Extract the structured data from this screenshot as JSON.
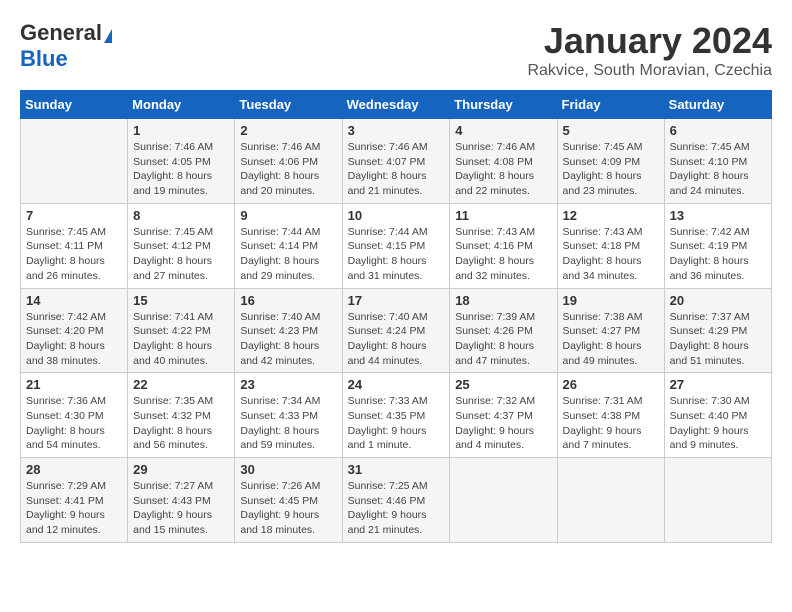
{
  "logo": {
    "general": "General",
    "blue": "Blue"
  },
  "title": "January 2024",
  "subtitle": "Rakvice, South Moravian, Czechia",
  "days_of_week": [
    "Sunday",
    "Monday",
    "Tuesday",
    "Wednesday",
    "Thursday",
    "Friday",
    "Saturday"
  ],
  "weeks": [
    [
      {
        "day": "",
        "info": ""
      },
      {
        "day": "1",
        "info": "Sunrise: 7:46 AM\nSunset: 4:05 PM\nDaylight: 8 hours and 19 minutes."
      },
      {
        "day": "2",
        "info": "Sunrise: 7:46 AM\nSunset: 4:06 PM\nDaylight: 8 hours and 20 minutes."
      },
      {
        "day": "3",
        "info": "Sunrise: 7:46 AM\nSunset: 4:07 PM\nDaylight: 8 hours and 21 minutes."
      },
      {
        "day": "4",
        "info": "Sunrise: 7:46 AM\nSunset: 4:08 PM\nDaylight: 8 hours and 22 minutes."
      },
      {
        "day": "5",
        "info": "Sunrise: 7:45 AM\nSunset: 4:09 PM\nDaylight: 8 hours and 23 minutes."
      },
      {
        "day": "6",
        "info": "Sunrise: 7:45 AM\nSunset: 4:10 PM\nDaylight: 8 hours and 24 minutes."
      }
    ],
    [
      {
        "day": "7",
        "info": "Sunrise: 7:45 AM\nSunset: 4:11 PM\nDaylight: 8 hours and 26 minutes."
      },
      {
        "day": "8",
        "info": "Sunrise: 7:45 AM\nSunset: 4:12 PM\nDaylight: 8 hours and 27 minutes."
      },
      {
        "day": "9",
        "info": "Sunrise: 7:44 AM\nSunset: 4:14 PM\nDaylight: 8 hours and 29 minutes."
      },
      {
        "day": "10",
        "info": "Sunrise: 7:44 AM\nSunset: 4:15 PM\nDaylight: 8 hours and 31 minutes."
      },
      {
        "day": "11",
        "info": "Sunrise: 7:43 AM\nSunset: 4:16 PM\nDaylight: 8 hours and 32 minutes."
      },
      {
        "day": "12",
        "info": "Sunrise: 7:43 AM\nSunset: 4:18 PM\nDaylight: 8 hours and 34 minutes."
      },
      {
        "day": "13",
        "info": "Sunrise: 7:42 AM\nSunset: 4:19 PM\nDaylight: 8 hours and 36 minutes."
      }
    ],
    [
      {
        "day": "14",
        "info": "Sunrise: 7:42 AM\nSunset: 4:20 PM\nDaylight: 8 hours and 38 minutes."
      },
      {
        "day": "15",
        "info": "Sunrise: 7:41 AM\nSunset: 4:22 PM\nDaylight: 8 hours and 40 minutes."
      },
      {
        "day": "16",
        "info": "Sunrise: 7:40 AM\nSunset: 4:23 PM\nDaylight: 8 hours and 42 minutes."
      },
      {
        "day": "17",
        "info": "Sunrise: 7:40 AM\nSunset: 4:24 PM\nDaylight: 8 hours and 44 minutes."
      },
      {
        "day": "18",
        "info": "Sunrise: 7:39 AM\nSunset: 4:26 PM\nDaylight: 8 hours and 47 minutes."
      },
      {
        "day": "19",
        "info": "Sunrise: 7:38 AM\nSunset: 4:27 PM\nDaylight: 8 hours and 49 minutes."
      },
      {
        "day": "20",
        "info": "Sunrise: 7:37 AM\nSunset: 4:29 PM\nDaylight: 8 hours and 51 minutes."
      }
    ],
    [
      {
        "day": "21",
        "info": "Sunrise: 7:36 AM\nSunset: 4:30 PM\nDaylight: 8 hours and 54 minutes."
      },
      {
        "day": "22",
        "info": "Sunrise: 7:35 AM\nSunset: 4:32 PM\nDaylight: 8 hours and 56 minutes."
      },
      {
        "day": "23",
        "info": "Sunrise: 7:34 AM\nSunset: 4:33 PM\nDaylight: 8 hours and 59 minutes."
      },
      {
        "day": "24",
        "info": "Sunrise: 7:33 AM\nSunset: 4:35 PM\nDaylight: 9 hours and 1 minute."
      },
      {
        "day": "25",
        "info": "Sunrise: 7:32 AM\nSunset: 4:37 PM\nDaylight: 9 hours and 4 minutes."
      },
      {
        "day": "26",
        "info": "Sunrise: 7:31 AM\nSunset: 4:38 PM\nDaylight: 9 hours and 7 minutes."
      },
      {
        "day": "27",
        "info": "Sunrise: 7:30 AM\nSunset: 4:40 PM\nDaylight: 9 hours and 9 minutes."
      }
    ],
    [
      {
        "day": "28",
        "info": "Sunrise: 7:29 AM\nSunset: 4:41 PM\nDaylight: 9 hours and 12 minutes."
      },
      {
        "day": "29",
        "info": "Sunrise: 7:27 AM\nSunset: 4:43 PM\nDaylight: 9 hours and 15 minutes."
      },
      {
        "day": "30",
        "info": "Sunrise: 7:26 AM\nSunset: 4:45 PM\nDaylight: 9 hours and 18 minutes."
      },
      {
        "day": "31",
        "info": "Sunrise: 7:25 AM\nSunset: 4:46 PM\nDaylight: 9 hours and 21 minutes."
      },
      {
        "day": "",
        "info": ""
      },
      {
        "day": "",
        "info": ""
      },
      {
        "day": "",
        "info": ""
      }
    ]
  ]
}
